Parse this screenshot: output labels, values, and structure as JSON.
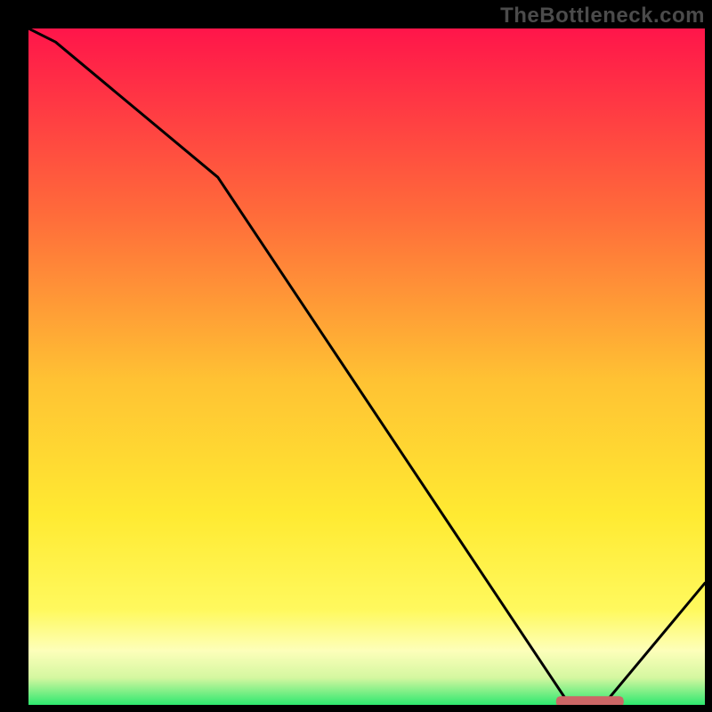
{
  "watermark": "TheBottleneck.com",
  "chart_data": {
    "type": "line",
    "title": "",
    "xlabel": "",
    "ylabel": "",
    "xlim": [
      0,
      100
    ],
    "ylim": [
      0,
      100
    ],
    "gradient_background": {
      "top_color": "#ff154a",
      "mid_top_color": "#ff8d36",
      "mid_color": "#ffe731",
      "low_color": "#fffca8",
      "bottom_color": "#2ee86f"
    },
    "series": [
      {
        "name": "bottleneck-curve",
        "x": [
          0,
          4,
          28,
          80,
          85,
          100
        ],
        "y": [
          100,
          98,
          78,
          0,
          0,
          18
        ]
      }
    ],
    "marker": {
      "name": "optimal-range",
      "x_start": 78,
      "x_end": 88,
      "y": 0.5,
      "color": "#cc6666"
    }
  }
}
